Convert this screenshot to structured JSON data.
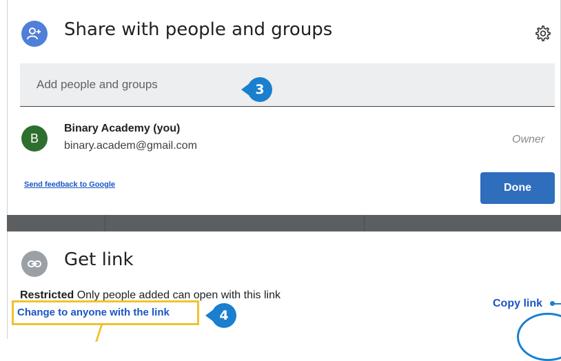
{
  "share": {
    "title": "Share with people and groups",
    "icon": "add-person-icon",
    "settings_icon": "gear-icon",
    "add_placeholder": "Add people and groups",
    "callout_number": "3"
  },
  "people": [
    {
      "avatar_letter": "B",
      "name": "Binary Academy (you)",
      "email": "binary.academ@gmail.com",
      "role": "Owner"
    }
  ],
  "footer": {
    "feedback_link": "Send feedback to Google",
    "done_label": "Done"
  },
  "get_link": {
    "title": "Get link",
    "icon": "link-icon",
    "restricted_bold": "Restricted",
    "restricted_text": " Only people added can open with this link",
    "change_link": "Change to anyone with the link",
    "callout_number": "4",
    "copy_link": "Copy link"
  },
  "colors": {
    "accent": "#2f6dbd",
    "callout": "#1a7fce",
    "highlight": "#f2c12e",
    "avatar": "#2e6f2f"
  }
}
